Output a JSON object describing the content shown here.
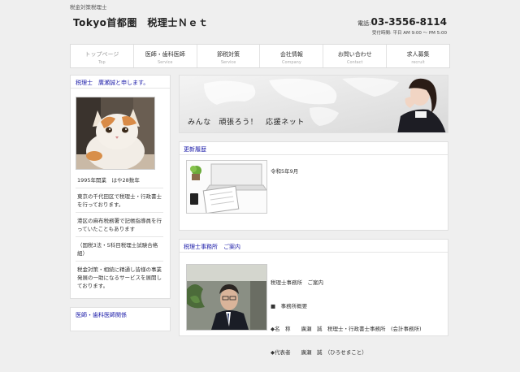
{
  "header": {
    "top_text": "税金対策税理士",
    "site_title": "Tokyo首都圏　税理士Ｎｅｔ",
    "phone_label": "電話:",
    "phone_number": "03-3556-8114",
    "hours": "受付時間: 平日 AM 9:00 〜 PM 5:00"
  },
  "nav": [
    {
      "jp": "トップページ",
      "en": "Top"
    },
    {
      "jp": "医師・歯科医師",
      "en": "Service"
    },
    {
      "jp": "節税対策",
      "en": "Service"
    },
    {
      "jp": "会社情報",
      "en": "Company"
    },
    {
      "jp": "お問い合わせ",
      "en": "Contact"
    },
    {
      "jp": "求人募集",
      "en": "recruit"
    }
  ],
  "sidebar": {
    "profile_heading": "税理士　廣瀬誠と申します。",
    "bio": [
      "1995年開業　はや28数年",
      "東京の千代田区で税理士・行政書士を行っております。",
      "港区の麻布税務署で記帳指導員を行っていたこともあります",
      "（国税3法・5科目税理士試験合格組）",
      "税金対策・相続に精通し皆様の事業発展の一助になるサービスを展開しております。"
    ],
    "section2_heading": "医師・歯科医師関係"
  },
  "banner": {
    "text": "みんな　頑張ろう！　応援ネット"
  },
  "news": {
    "heading": "更新履歴",
    "date": "令和5年9月"
  },
  "office": {
    "heading": "税理士事務所　ご案内",
    "lines": [
      "税理士事務所　ご案内",
      "■　事務所概要",
      "◆名　称　　廣瀬　誠　税理士・行政書士事務所　(会計事務所)",
      "◆代表者　　廣瀬　誠　（ひろせまこと）"
    ]
  }
}
